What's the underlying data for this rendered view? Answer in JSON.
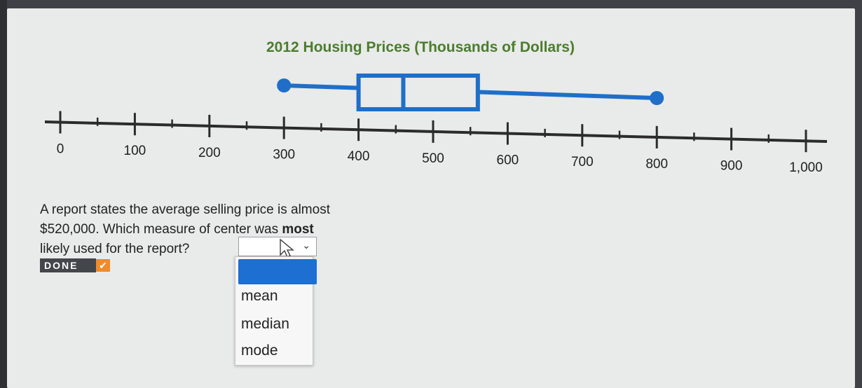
{
  "chart_data": {
    "type": "boxplot",
    "title": "2012 Housing Prices (Thousands of Dollars)",
    "axis": {
      "min": 0,
      "max": 1000,
      "major_ticks": [
        0,
        100,
        200,
        300,
        400,
        500,
        600,
        700,
        800,
        900,
        1000
      ],
      "tick_labels": [
        "0",
        "100",
        "200",
        "300",
        "400",
        "500",
        "600",
        "700",
        "800",
        "900",
        "1,000"
      ],
      "minor_ticks": [
        50,
        150,
        250,
        350,
        450,
        550,
        650,
        750,
        850,
        950
      ]
    },
    "box": {
      "min": 300,
      "q1": 400,
      "median": 460,
      "q3": 560,
      "max": 800
    },
    "colors": {
      "box": "#1f6fc8",
      "axis": "#2b2b2b",
      "title": "#4b7d2c"
    }
  },
  "question": {
    "line1": "A report states the average selling price is almost",
    "line2_pre": "$520,000. Which measure of center was ",
    "line2_bold": "most",
    "line3": "likely used for the report?"
  },
  "select": {
    "chevron": "⌄"
  },
  "done": {
    "label": "DONE",
    "check_icon": "✔"
  },
  "dropdown": {
    "options": [
      "mean",
      "median",
      "mode"
    ]
  }
}
